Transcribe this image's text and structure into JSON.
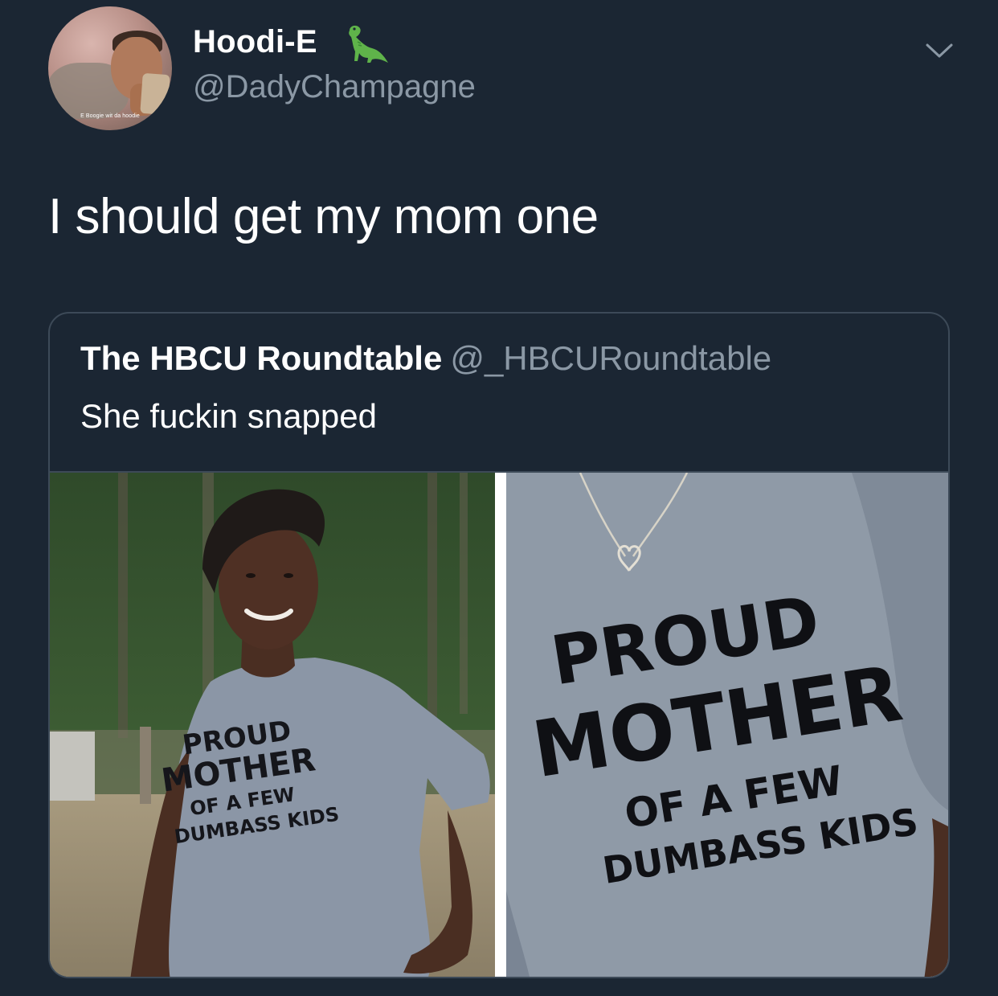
{
  "author": {
    "display_name": "Hoodi-E",
    "handle": "@DadyChampagne",
    "avatar_caption": "E Boogie wit da hoodie",
    "badge_icon": "dinosaur-icon"
  },
  "tweet": {
    "text": "I should get my mom one"
  },
  "quoted_tweet": {
    "display_name": "The HBCU Roundtable",
    "handle": "@_HBCURoundtable",
    "text": "She fuckin snapped",
    "media": {
      "left_photo_shirt_text": [
        "PROUD",
        "MOTHER",
        "OF A FEW",
        "DUMBASS KIDS"
      ],
      "right_photo_shirt_text": [
        "PROUD",
        "MOTHER",
        "OF A FEW",
        "DUMBASS KIDS"
      ]
    }
  },
  "colors": {
    "background": "#1b2633",
    "secondary_text": "#8b98a5",
    "border": "#3d4a58",
    "shirt_gray": "#8b96a3"
  }
}
